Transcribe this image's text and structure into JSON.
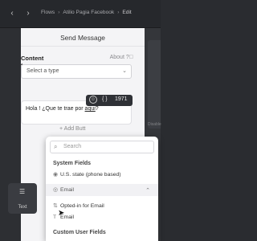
{
  "topbar": {
    "breadcrumb": [
      "Flows",
      "Atilio Pagia Facebook",
      "Edit"
    ]
  },
  "panel": {
    "title": "Send Message",
    "content_type_label": "Content type",
    "about_label": "About",
    "select_placeholder": "Select a type",
    "message_prefix": "Hola ! ¿Que te trae por ",
    "message_link": "aqui",
    "message_suffix": "?",
    "add_button_label": "+ Add Butt",
    "char_count": "1971"
  },
  "dropdown": {
    "search_placeholder": "Search",
    "sections": {
      "system": "System Fields",
      "custom": "Custom User Fields"
    },
    "items": [
      {
        "label": "U.S. state (phone based)",
        "icon": "user-icon"
      },
      {
        "label": "Email",
        "icon": "email-icon"
      },
      {
        "label": "Opted-in for Email",
        "icon": "sort-icon"
      },
      {
        "label": "Email",
        "icon": "text-icon"
      }
    ]
  },
  "left_tile": {
    "label": "Text",
    "icon": "text-lines-icon"
  },
  "right_edge": {
    "label": "Disable"
  }
}
